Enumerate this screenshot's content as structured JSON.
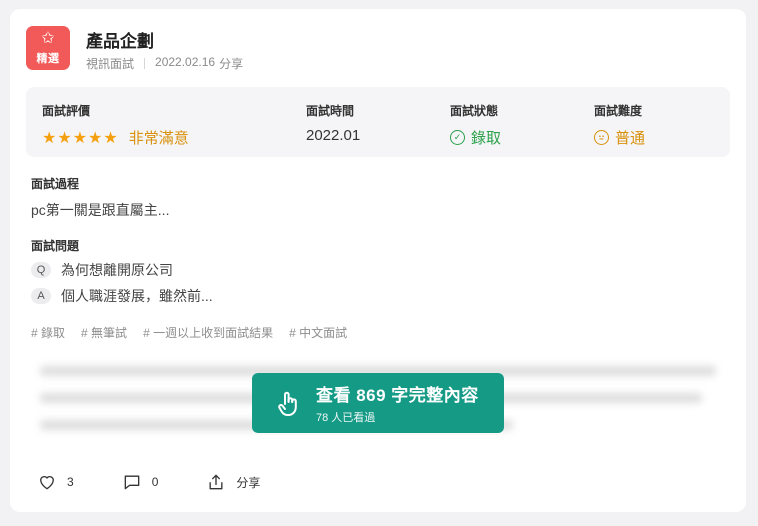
{
  "badge": {
    "icon": "star-medal-icon",
    "label": "精選"
  },
  "title": "產品企劃",
  "meta": {
    "type": "視訊面試",
    "date": "2022.02.16",
    "action": "分享"
  },
  "stats": {
    "rating": {
      "label": "面試評價",
      "stars": "★★★★★",
      "text": "非常滿意"
    },
    "time": {
      "label": "面試時間",
      "value": "2022.01"
    },
    "status": {
      "label": "面試狀態",
      "value": "錄取",
      "icon": "check-circle-icon"
    },
    "difficulty": {
      "label": "面試難度",
      "value": "普通",
      "icon": "neutral-face-icon"
    }
  },
  "process": {
    "label": "面試過程",
    "text": "pc第一關是跟直屬主..."
  },
  "questions": {
    "label": "面試問題",
    "q_tag": "Q",
    "q_text": "為何想離開原公司",
    "a_tag": "A",
    "a_text": "個人職涯發展，雖然前..."
  },
  "tags": [
    "錄取",
    "無筆試",
    "一週以上收到面試結果",
    "中文面試"
  ],
  "cta": {
    "main": "查看 869 字完整內容",
    "sub": "78 人已看過"
  },
  "footer": {
    "likes": "3",
    "comments": "0",
    "share": "分享"
  },
  "colors": {
    "accent": "#159a86",
    "badge": "#f25a5a",
    "stars": "#f5a00f",
    "success": "#2aa14a"
  }
}
